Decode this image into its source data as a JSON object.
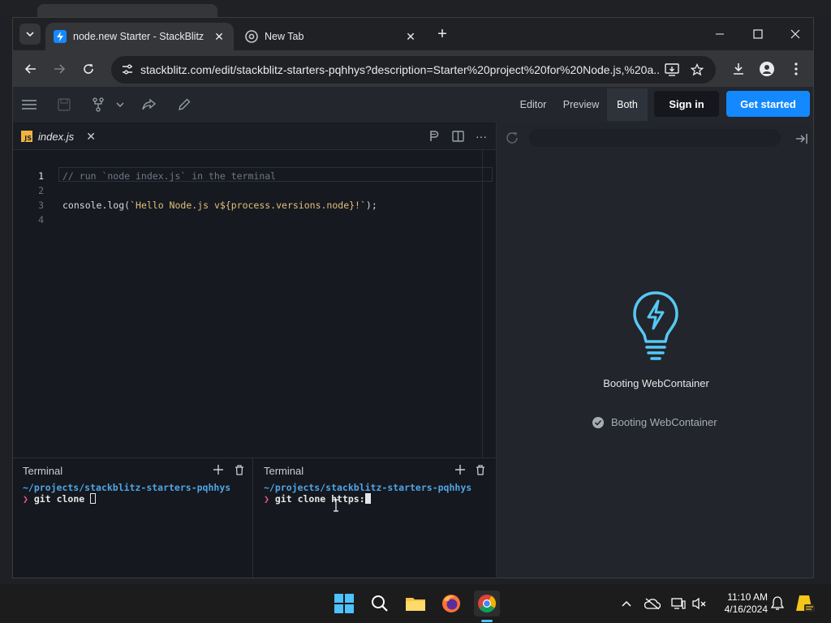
{
  "browser": {
    "tabs": [
      {
        "title": "node.new Starter - StackBlitz",
        "active": true,
        "favicon": "stackblitz-bolt-icon"
      },
      {
        "title": "New Tab",
        "active": false,
        "favicon": "chrome-icon"
      }
    ],
    "url": "stackblitz.com/edit/stackblitz-starters-pqhhys?description=Starter%20project%20for%20Node.js,%20a..."
  },
  "app": {
    "view_tabs": [
      "Editor",
      "Preview",
      "Both"
    ],
    "active_view": "Both",
    "sign_in": "Sign in",
    "get_started": "Get started"
  },
  "editor": {
    "filename": "index.js",
    "badge": "JS",
    "lines": [
      {
        "num": "1",
        "text": "// run `node index.js` in the terminal"
      },
      {
        "num": "2",
        "text": ""
      },
      {
        "num": "3",
        "text": "console.log(`Hello Node.js v${process.versions.node}!`);"
      },
      {
        "num": "4",
        "text": ""
      }
    ]
  },
  "terminals": [
    {
      "label": "Terminal",
      "path": "~/projects/stackblitz-starters-pqhhys",
      "prompt": "❯",
      "command": "git clone "
    },
    {
      "label": "Terminal",
      "path": "~/projects/stackblitz-starters-pqhhys",
      "prompt": "❯",
      "command": "git clone https:"
    }
  ],
  "preview": {
    "title": "Booting WebContainer",
    "status": "Booting WebContainer"
  },
  "taskbar": {
    "time": "11:10 AM",
    "date": "4/16/2024"
  },
  "colors": {
    "accent": "#1389fd",
    "bulb": "#56c8f5",
    "prompt": "#e25a86",
    "path": "#4fa5e6"
  }
}
